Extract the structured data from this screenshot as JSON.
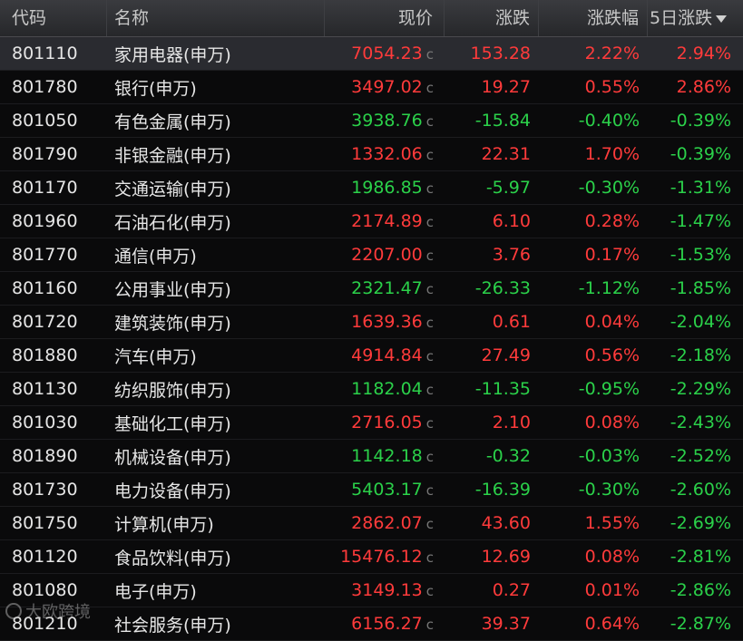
{
  "header": {
    "code": "代码",
    "name": "名称",
    "price": "现价",
    "change": "涨跌",
    "pct": "涨跌幅",
    "five_day": "5日涨跌"
  },
  "colors": {
    "up": "#ff3b3b",
    "down": "#2bd14a"
  },
  "price_suffix": "c",
  "rows": [
    {
      "code": "801110",
      "name": "家用电器(申万)",
      "price": "7054.23",
      "change": "153.28",
      "pct": "2.22%",
      "five_day": "2.94%",
      "dir": "up",
      "dir5": "up",
      "selected": true
    },
    {
      "code": "801780",
      "name": "银行(申万)",
      "price": "3497.02",
      "change": "19.27",
      "pct": "0.55%",
      "five_day": "2.86%",
      "dir": "up",
      "dir5": "up"
    },
    {
      "code": "801050",
      "name": "有色金属(申万)",
      "price": "3938.76",
      "change": "-15.84",
      "pct": "-0.40%",
      "five_day": "-0.39%",
      "dir": "down",
      "dir5": "down"
    },
    {
      "code": "801790",
      "name": "非银金融(申万)",
      "price": "1332.06",
      "change": "22.31",
      "pct": "1.70%",
      "five_day": "-0.39%",
      "dir": "up",
      "dir5": "down"
    },
    {
      "code": "801170",
      "name": "交通运输(申万)",
      "price": "1986.85",
      "change": "-5.97",
      "pct": "-0.30%",
      "five_day": "-1.31%",
      "dir": "down",
      "dir5": "down"
    },
    {
      "code": "801960",
      "name": "石油石化(申万)",
      "price": "2174.89",
      "change": "6.10",
      "pct": "0.28%",
      "five_day": "-1.47%",
      "dir": "up",
      "dir5": "down"
    },
    {
      "code": "801770",
      "name": "通信(申万)",
      "price": "2207.00",
      "change": "3.76",
      "pct": "0.17%",
      "five_day": "-1.53%",
      "dir": "up",
      "dir5": "down"
    },
    {
      "code": "801160",
      "name": "公用事业(申万)",
      "price": "2321.47",
      "change": "-26.33",
      "pct": "-1.12%",
      "five_day": "-1.85%",
      "dir": "down",
      "dir5": "down"
    },
    {
      "code": "801720",
      "name": "建筑装饰(申万)",
      "price": "1639.36",
      "change": "0.61",
      "pct": "0.04%",
      "five_day": "-2.04%",
      "dir": "up",
      "dir5": "down"
    },
    {
      "code": "801880",
      "name": "汽车(申万)",
      "price": "4914.84",
      "change": "27.49",
      "pct": "0.56%",
      "five_day": "-2.18%",
      "dir": "up",
      "dir5": "down"
    },
    {
      "code": "801130",
      "name": "纺织服饰(申万)",
      "price": "1182.04",
      "change": "-11.35",
      "pct": "-0.95%",
      "five_day": "-2.29%",
      "dir": "down",
      "dir5": "down"
    },
    {
      "code": "801030",
      "name": "基础化工(申万)",
      "price": "2716.05",
      "change": "2.10",
      "pct": "0.08%",
      "five_day": "-2.43%",
      "dir": "up",
      "dir5": "down"
    },
    {
      "code": "801890",
      "name": "机械设备(申万)",
      "price": "1142.18",
      "change": "-0.32",
      "pct": "-0.03%",
      "five_day": "-2.52%",
      "dir": "down",
      "dir5": "down"
    },
    {
      "code": "801730",
      "name": "电力设备(申万)",
      "price": "5403.17",
      "change": "-16.39",
      "pct": "-0.30%",
      "five_day": "-2.60%",
      "dir": "down",
      "dir5": "down"
    },
    {
      "code": "801750",
      "name": "计算机(申万)",
      "price": "2862.07",
      "change": "43.60",
      "pct": "1.55%",
      "five_day": "-2.69%",
      "dir": "up",
      "dir5": "down"
    },
    {
      "code": "801120",
      "name": "食品饮料(申万)",
      "price": "15476.12",
      "change": "12.69",
      "pct": "0.08%",
      "five_day": "-2.81%",
      "dir": "up",
      "dir5": "down"
    },
    {
      "code": "801080",
      "name": "电子(申万)",
      "price": "3149.13",
      "change": "0.27",
      "pct": "0.01%",
      "five_day": "-2.86%",
      "dir": "up",
      "dir5": "down"
    },
    {
      "code": "801210",
      "name": "社会服务(申万)",
      "price": "6156.27",
      "change": "39.37",
      "pct": "0.64%",
      "five_day": "-2.87%",
      "dir": "up",
      "dir5": "down"
    }
  ],
  "watermark": "大欧跨境"
}
